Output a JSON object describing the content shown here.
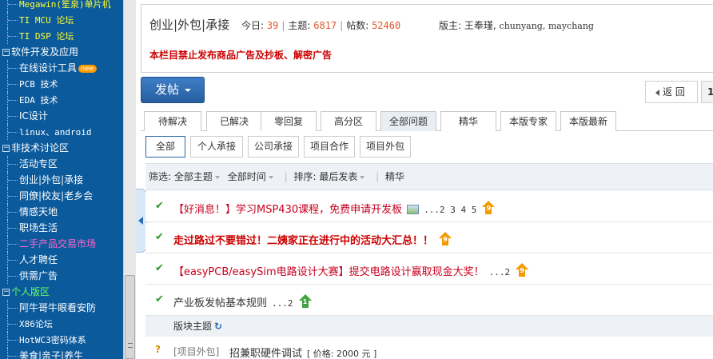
{
  "sidebar": {
    "rows": [
      {
        "label": "Megawin(笙泉)单片机",
        "type": "leaf",
        "color": "yellow",
        "mono": true
      },
      {
        "label": "TI MCU 论坛",
        "type": "leaf",
        "color": "yellow",
        "mono": true
      },
      {
        "label": "TI DSP 论坛",
        "type": "leaf",
        "color": "yellow",
        "mono": true
      },
      {
        "label": "软件开发及应用",
        "type": "cat",
        "color": "white",
        "toggle": "−"
      },
      {
        "label": "在线设计工具",
        "type": "leaf",
        "color": "white",
        "badge": "new"
      },
      {
        "label": "PCB 技术",
        "type": "leaf",
        "color": "white",
        "mono": true
      },
      {
        "label": "EDA 技术",
        "type": "leaf",
        "color": "white",
        "mono": true
      },
      {
        "label": "IC设计",
        "type": "leaf",
        "color": "white"
      },
      {
        "label": "linux、android",
        "type": "leaf",
        "color": "white",
        "mono": true
      },
      {
        "label": "非技术讨论区",
        "type": "cat",
        "color": "white",
        "toggle": "−"
      },
      {
        "label": "活动专区",
        "type": "leaf",
        "color": "white"
      },
      {
        "label": "创业|外包|承接",
        "type": "leaf",
        "color": "white"
      },
      {
        "label": "同僚|校友|老乡会",
        "type": "leaf",
        "color": "white"
      },
      {
        "label": "情感天地",
        "type": "leaf",
        "color": "white"
      },
      {
        "label": "职场生活",
        "type": "leaf",
        "color": "white"
      },
      {
        "label": "二手产品交易市场",
        "type": "leaf",
        "color": "pink"
      },
      {
        "label": "人才聘任",
        "type": "leaf",
        "color": "white"
      },
      {
        "label": "供需广告",
        "type": "leaf",
        "color": "white"
      },
      {
        "label": "个人版区",
        "type": "cat",
        "color": "green",
        "toggle": "−"
      },
      {
        "label": "阿牛哥牛眼看安防",
        "type": "leaf",
        "color": "white"
      },
      {
        "label": "X86论坛",
        "type": "leaf",
        "color": "white",
        "mono": true
      },
      {
        "label": "HotWC3密码体系",
        "type": "leaf",
        "color": "white",
        "mono": true
      },
      {
        "label": "美食|亲子|养生",
        "type": "leaf",
        "color": "white"
      }
    ]
  },
  "header": {
    "title": "创业|外包|承接",
    "today_label": "今日:",
    "today_value": "39",
    "topics_label": "主题:",
    "topics_value": "6817",
    "posts_label": "帖数:",
    "posts_value": "52460",
    "mods_label": "版主:",
    "mods_primary": "王奉瑾,",
    "mods_others": "chunyang, maychang",
    "notice": "本栏目禁止发布商品广告及抄板、解密广告"
  },
  "toolbar": {
    "post_label": "发帖",
    "back_label": "返 回",
    "page_label": "1"
  },
  "tabs": [
    {
      "label": "待解决"
    },
    {
      "label": "已解决"
    },
    {
      "label": "零回复"
    },
    {
      "label": "高分区"
    },
    {
      "label": "全部问题"
    },
    {
      "label": "精华"
    },
    {
      "label": "本版专家"
    },
    {
      "label": "本版最新"
    }
  ],
  "subtabs": [
    {
      "label": "全部"
    },
    {
      "label": "个人承接"
    },
    {
      "label": "公司承接"
    },
    {
      "label": "项目合作"
    },
    {
      "label": "项目外包"
    }
  ],
  "filter": {
    "label": "筛选:",
    "topic": "全部主题",
    "time": "全部时间",
    "sort_label": "排序:",
    "sort": "最后发表",
    "digest": "精华"
  },
  "threads": [
    {
      "title": "【好消息！】学习MSP430课程，免费申请开发板",
      "pages": "...2 3 4 5",
      "style": "pink",
      "has_image": true,
      "hot_level": "9"
    },
    {
      "title": "走过路过不要错过！二姨家正在进行中的活动大汇总！！",
      "pages": "",
      "style": "red",
      "has_image": false,
      "hot_level": "9"
    },
    {
      "title": "【easyPCB/easySim电路设计大赛】提交电路设计赢取现金大奖！",
      "pages": "...2",
      "style": "pink",
      "has_image": false,
      "hot_level": "9"
    },
    {
      "title": "产业板发帖基本规则",
      "pages": "...2",
      "style": "dark",
      "has_image": false,
      "hot_level": "1"
    }
  ],
  "section": {
    "label": "版块主题",
    "refresh": "↻"
  },
  "last_thread": {
    "category": "[项目外包]",
    "title": "招兼职硬件调试",
    "price": "[ 价格: 2000 元 ]"
  }
}
